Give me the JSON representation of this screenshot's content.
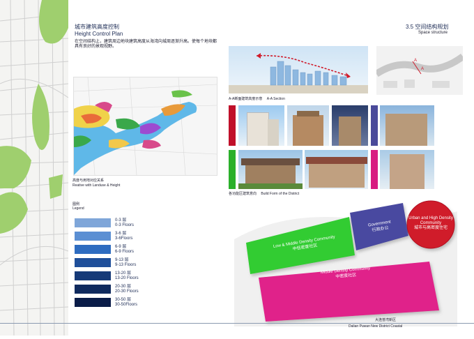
{
  "left": {
    "title_cn": "城市建筑高度控制",
    "title_en": "Height Control Plan",
    "paragraph": "在空间结构上，建筑周边地块建筑高度从海湾向城周逐渐升高。使每个地块都具有良好的景观视野。",
    "map_caption_cn": "高度与用地对应关系",
    "map_caption_en": "Reative with Landuse & Height",
    "legend_title_cn": "图例",
    "legend_title_en": "Legend",
    "legend": [
      {
        "cn": "0-3 层",
        "en": "0-3 Floors",
        "color": "#7fa6d9"
      },
      {
        "cn": "3-6 层",
        "en": "3-6Floors",
        "color": "#5b8fd3"
      },
      {
        "cn": "6-9 层",
        "en": "6-9 Floors",
        "color": "#2e6cc0"
      },
      {
        "cn": "9-13 层",
        "en": "9-13 Floors",
        "color": "#1f4f9a"
      },
      {
        "cn": "13-20 层",
        "en": "13-20 Floors",
        "color": "#163a78"
      },
      {
        "cn": "20-30 层",
        "en": "20-30 Floors",
        "color": "#0f2a5e"
      },
      {
        "cn": "30-50 层",
        "en": "30-50Floors",
        "color": "#0a1c48"
      }
    ]
  },
  "right": {
    "title_cn": "3.5 空间结构规划",
    "title_en": "Space structure",
    "section_caption_cn": "A-A断面建筑高度示意",
    "section_caption_en": "A-A Section",
    "form_caption_cn": "各功能区建筑意向",
    "form_caption_en": "Build Form of the District",
    "zones": {
      "low_mid_en": "Low & Middle Density Community",
      "low_mid_cn": "中低密度社区",
      "government_en": "Government",
      "government_cn": "行政办公",
      "urban_high_en": "Urban and High Density Community",
      "urban_high_cn": "城市与高密度住宅",
      "middle_en": "Middle Density Community",
      "middle_cn": "中密度社区"
    },
    "colors": {
      "green": "#33cc33",
      "magenta": "#e0218a",
      "purple": "#4a4aa0",
      "red": "#d01a2a",
      "band_red": "#c0102a",
      "band_purple": "#4a4a9a",
      "band_green": "#2ab02a",
      "band_magenta": "#d81b80"
    },
    "marker_a": "A",
    "footer_cn": "大连普湾新区",
    "footer_en": "Dalian Puwan New District Coastal"
  }
}
